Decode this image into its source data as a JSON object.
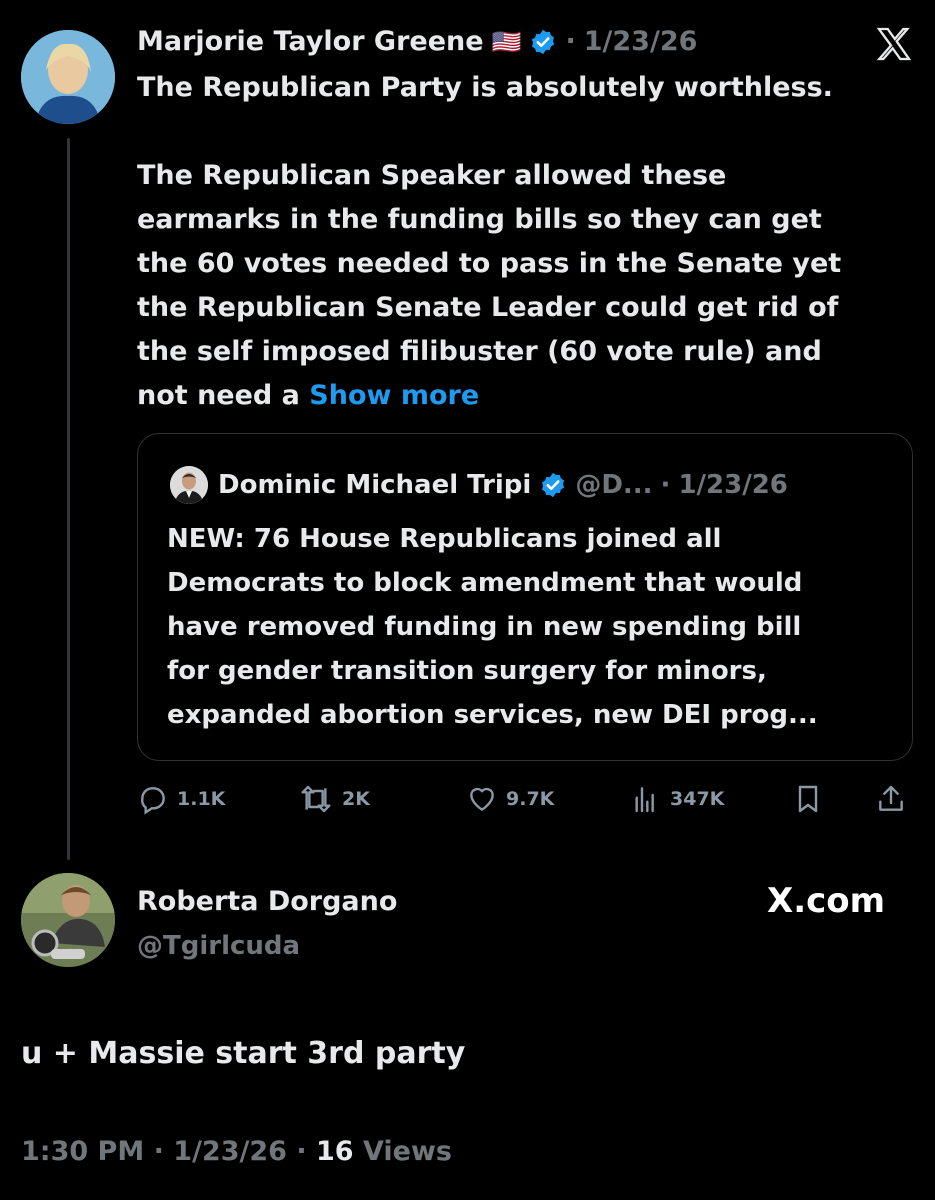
{
  "tweet": {
    "author_name": "Marjorie Taylor Greene",
    "flag": "🇺🇸",
    "separator": "·",
    "date": "1/23/26",
    "body": "The Republican Party is absolutely worthless.\n\nThe Republican Speaker allowed these\nearmarks in the funding bills so they can get\nthe 60 votes needed to pass in the Senate yet\nthe Republican Senate Leader could get rid of\nthe self imposed filibuster (60 vote rule) and\nnot need a ",
    "show_more": "Show more",
    "quote": {
      "author_name": "Dominic Michael Tripi",
      "handle": "@D...",
      "separator": "·",
      "date": "1/23/26",
      "body": "NEW: 76 House Republicans joined all\nDemocrats to block amendment that would\nhave removed funding in new spending bill\nfor gender transition surgery for minors,\nexpanded abortion services, new DEI prog..."
    },
    "actions": {
      "replies": "1.1K",
      "reposts": "2K",
      "likes": "9.7K",
      "views": "347K"
    }
  },
  "reply": {
    "author_name": "Roberta Dorgano",
    "handle": "@Tgirlcuda",
    "body": "u + Massie start 3rd party",
    "time": "1:30 PM",
    "sep1": " · ",
    "date": "1/23/26",
    "sep2": " · ",
    "views_count": "16",
    "views_label": "Views"
  },
  "watermark": "X.com",
  "x_logo": "X",
  "icons": [
    "x-logo-icon",
    "verified-badge-icon",
    "reply-icon",
    "repost-icon",
    "like-icon",
    "views-icon",
    "bookmark-icon",
    "share-icon"
  ],
  "colors": {
    "background": "#000000",
    "text": "#e7e9ea",
    "muted": "#71767b",
    "link": "#1d9bf0",
    "verified": "#1d9bf0",
    "border": "#2f3336"
  }
}
